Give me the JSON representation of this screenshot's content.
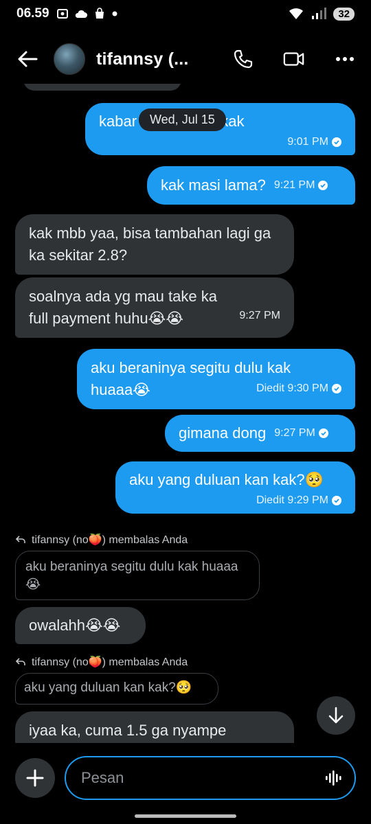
{
  "status_bar": {
    "time": "06.59",
    "battery": "32"
  },
  "header": {
    "contact_name": "tifannsy (..."
  },
  "date_chip": "Wed, Jul 15",
  "messages": [
    {
      "text": "kabar bisa vc yaa kak",
      "time": "9:01 PM"
    },
    {
      "text": "kak masi lama?",
      "time": "9:21 PM"
    },
    {
      "text": "kak mbb yaa, bisa tambahan lagi ga ka sekitar 2.8?"
    },
    {
      "text": "soalnya ada yg mau take ka full payment huhu😭😭",
      "time": "9:27 PM"
    },
    {
      "text": "aku beraninya segitu dulu kak huaaa😭",
      "time": "Diedit 9:30 PM"
    },
    {
      "text": "gimana dong",
      "time": "9:27 PM"
    },
    {
      "text": "aku yang duluan kan kak?🥺",
      "time": "Diedit 9:29 PM"
    },
    {
      "reply_label": "tifannsy (no🍑) membalas Anda",
      "quote": "aku beraninya segitu dulu kak huaaa😭"
    },
    {
      "text": "owalahh😭😭"
    },
    {
      "reply_label": "tifannsy (no🍑) membalas Anda",
      "quote": "aku yang duluan kan kak?🥺"
    },
    {
      "text": "iyaa ka, cuma 1.5 ga nyampe"
    }
  ],
  "composer": {
    "placeholder": "Pesan"
  },
  "colors": {
    "accent": "#1d9bf0",
    "incoming": "#2f3336",
    "background": "#000000"
  }
}
